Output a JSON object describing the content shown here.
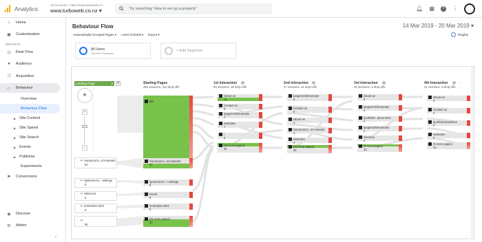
{
  "topbar": {
    "app_name": "Analytics",
    "crumb": "All accounts > http://www.turboweb.co...",
    "property": "www.turboweb.co.nz",
    "search_placeholder": "Try searching \"How to set up a property\"",
    "icons": [
      "bell-icon",
      "apps-icon",
      "help-icon",
      "more-icon",
      "avatar"
    ]
  },
  "sidebar": {
    "top_items": [
      {
        "label": "Home",
        "icon": "home-icon"
      },
      {
        "label": "Customisation",
        "icon": "customisation-icon"
      }
    ],
    "reports_heading": "REPORTS",
    "report_items": [
      {
        "label": "Real-Time",
        "icon": "clock-icon"
      },
      {
        "label": "Audience",
        "icon": "person-icon"
      },
      {
        "label": "Acquisition",
        "icon": "acquisition-icon"
      },
      {
        "label": "Behaviour",
        "icon": "behaviour-icon"
      }
    ],
    "behaviour_sub": [
      {
        "label": "Overview"
      },
      {
        "label": "Behaviour Flow"
      },
      {
        "label": "Site Content"
      },
      {
        "label": "Site Speed"
      },
      {
        "label": "Site Search"
      },
      {
        "label": "Events"
      },
      {
        "label": "Publisher"
      },
      {
        "label": "Experiments"
      }
    ],
    "conversions": "Conversions",
    "bottom_items": [
      {
        "label": "Discover",
        "icon": "discover-icon"
      },
      {
        "label": "Admin",
        "icon": "gear-icon"
      }
    ],
    "collapse_icon": "chevron-left-icon"
  },
  "report": {
    "title": "Behaviour Flow",
    "date_range": "14 Mar 2019 - 20 Mar 2019",
    "toolbar": [
      "Automatically Grouped Pages",
      "Level of Detail",
      "Export"
    ],
    "insights": "Insights",
    "segments": {
      "all_users": "All Users",
      "all_users_sub": "100.00% Sessions",
      "add_segment": "+ Add Segment"
    }
  },
  "flow": {
    "selector": "Landing Page",
    "columns": [
      {
        "name": "Starting Pages",
        "sub": "494 sessions, 411 drop-offs"
      },
      {
        "name": "1st Interaction",
        "sub": "83 sessions, 36 drop-offs"
      },
      {
        "name": "2nd Interaction",
        "sub": "47 sessions, 21 drop-offs"
      },
      {
        "name": "3rd Interaction",
        "sub": "26 sessions, 5 drop-offs"
      },
      {
        "name": "4th Interaction",
        "sub": "21 sessions, 9 drop-offs"
      }
    ],
    "sources": [
      {
        "label": "/vacancy/ca...ers-wanted",
        "value": "54"
      },
      {
        "label": "/general-em...-settings",
        "value": "9"
      },
      {
        "label": "/about-us",
        "value": "6"
      },
      {
        "label": "/tr4312541.html",
        "value": "5"
      },
      {
        "label": "",
        "value": "66"
      }
    ],
    "start_nodes": [
      {
        "label": "",
        "value": "381"
      },
      {
        "label": "/vacancy/ca...ers-wanted",
        "value": "57"
      },
      {
        "label": "/general-em...r-settings",
        "value": "9"
      },
      {
        "label": "/event",
        "value": "9"
      },
      {
        "label": "/tr4312541.html",
        "value": "5"
      },
      {
        "label": "(31 more pages)",
        "value": "33"
      }
    ],
    "col1": [
      {
        "label": "/about-us",
        "value": "23"
      },
      {
        "label": "/contact-us",
        "value": "9"
      },
      {
        "label": "/pages/10/showcase",
        "value": "7"
      },
      {
        "label": "/websites",
        "value": "7"
      },
      {
        "label": "/",
        "value": "6"
      },
      {
        "label": "(25 more pages)",
        "value": "29"
      }
    ],
    "col2": [
      {
        "label": "/pages/10/showcase",
        "value": "5"
      },
      {
        "label": "/contact-us",
        "value": "5"
      },
      {
        "label": "/about-us",
        "value": "4"
      },
      {
        "label": "/vacancy/ca...ers-wanted",
        "value": "3"
      },
      {
        "label": "/websites",
        "value": "2"
      },
      {
        "label": "(23 more pages)",
        "value": "28"
      }
    ],
    "col3": [
      {
        "label": "/about-us",
        "value": "5"
      },
      {
        "label": "/pages/10/showcase",
        "value": "2"
      },
      {
        "label": "/portfolio/...ljetus-view",
        "value": "2"
      },
      {
        "label": "/pages/20/showcase",
        "value": "2"
      },
      {
        "label": "/vacancy",
        "value": "2"
      },
      {
        "label": "(8 more pages)",
        "value": "15"
      }
    ],
    "col4": [
      {
        "label": "/about-us",
        "value": "3"
      },
      {
        "label": "/contact-us",
        "value": "2"
      },
      {
        "label": "/portfolio/smartfone",
        "value": "2"
      },
      {
        "label": "/websites",
        "value": "2"
      },
      {
        "label": "(5 more pages)",
        "value": "12"
      }
    ]
  }
}
